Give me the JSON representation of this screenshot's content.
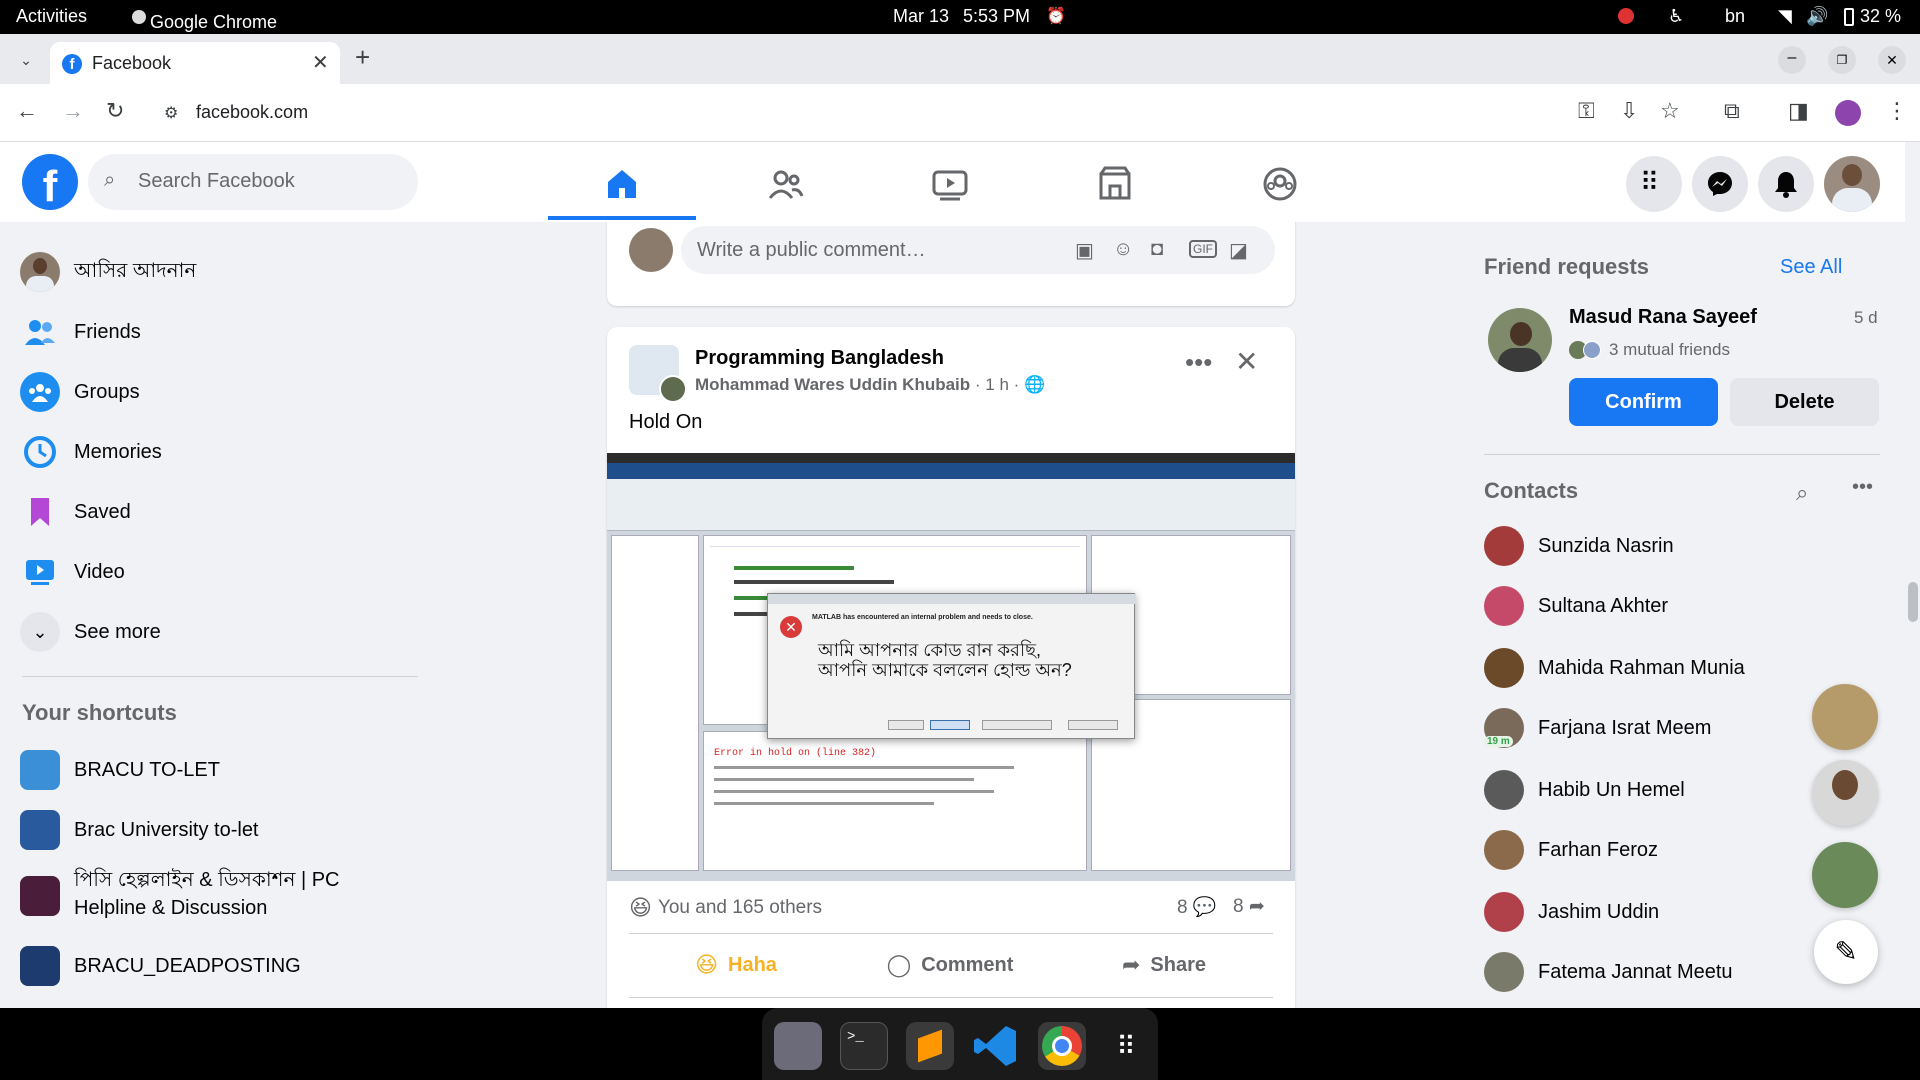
{
  "os_bar": {
    "activities": "Activities",
    "app": "Google Chrome",
    "date": "Mar 13",
    "time": "5:53 PM",
    "lang": "bn",
    "battery": "32 %"
  },
  "browser": {
    "tab_title": "Facebook",
    "url": "facebook.com"
  },
  "facebook": {
    "search_placeholder": "Search Facebook",
    "left_nav": [
      {
        "label": "আসির আদনান"
      },
      {
        "label": "Friends"
      },
      {
        "label": "Groups"
      },
      {
        "label": "Memories"
      },
      {
        "label": "Saved"
      },
      {
        "label": "Video"
      },
      {
        "label": "See more"
      }
    ],
    "shortcuts_title": "Your shortcuts",
    "shortcuts": [
      {
        "label": "BRACU TO-LET"
      },
      {
        "label": "Brac University to-let"
      },
      {
        "label": "পিসি হেল্পলাইন & ডিসকাশন | PC Helpline & Discussion"
      },
      {
        "label": "BRACU_DEADPOSTING"
      }
    ],
    "comment_placeholder": "Write a public comment…",
    "post": {
      "group": "Programming Bangladesh",
      "author": "Mohammad Wares Uddin Khubaib",
      "time": "1 h",
      "text": "Hold On",
      "meme_line1": "আমি আপনার কোড রান করছি,",
      "meme_line2": "আপনি আমাকে বললেন হোল্ড অন?",
      "matlab_error_title": "MATLAB has encountered an internal problem and needs to close.",
      "matlab_error_line": "Error in hold on (line 382)",
      "reactions": "You and 165 others",
      "comments_count": "8",
      "shares_count": "8",
      "actions": {
        "haha": "Haha",
        "comment": "Comment",
        "share": "Share"
      }
    },
    "friend_requests": {
      "title": "Friend requests",
      "see_all": "See All",
      "name": "Masud Rana Sayeef",
      "age": "5 d",
      "mutual": "3 mutual friends",
      "confirm": "Confirm",
      "delete": "Delete"
    },
    "contacts_title": "Contacts",
    "contacts": [
      {
        "name": "Sunzida Nasrin",
        "badge": ""
      },
      {
        "name": "Sultana Akhter",
        "badge": ""
      },
      {
        "name": "Mahida Rahman Munia",
        "badge": ""
      },
      {
        "name": "Farjana Israt Meem",
        "badge": "19 m"
      },
      {
        "name": "Habib Un Hemel",
        "badge": ""
      },
      {
        "name": "Farhan Feroz",
        "badge": ""
      },
      {
        "name": "Jashim Uddin",
        "badge": ""
      },
      {
        "name": "Fatema Jannat Meetu",
        "badge": ""
      }
    ]
  },
  "colors": {
    "fb_blue": "#1877f2",
    "bg": "#f0f2f5",
    "haha": "#f7b125"
  }
}
